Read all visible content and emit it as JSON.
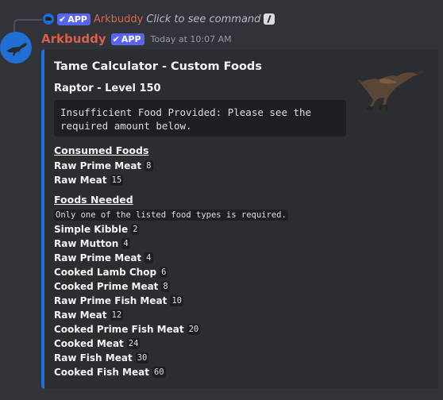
{
  "reply": {
    "badge": "APP",
    "name": "Arkbuddy",
    "command_text": "Click to see command"
  },
  "message": {
    "author": "Arkbuddy",
    "badge": "APP",
    "timestamp": "Today at 10:07 AM"
  },
  "embed": {
    "accent_color": "#1f6fe0",
    "title": "Tame Calculator - Custom Foods",
    "subtitle": "Raptor - Level 150",
    "code": "Insufficient Food Provided: Please see the\nrequired amount below.",
    "consumed_title": "Consumed Foods",
    "consumed": [
      {
        "name": "Raw Prime Meat",
        "qty": "8"
      },
      {
        "name": "Raw Meat",
        "qty": "15"
      }
    ],
    "needed_title": "Foods Needed",
    "needed_note": "Only one of the listed food types is required.",
    "needed": [
      {
        "name": "Simple Kibble",
        "qty": "2"
      },
      {
        "name": "Raw Mutton",
        "qty": "4"
      },
      {
        "name": "Raw Prime Meat",
        "qty": "4"
      },
      {
        "name": "Cooked Lamb Chop",
        "qty": "6"
      },
      {
        "name": "Cooked Prime Meat",
        "qty": "8"
      },
      {
        "name": "Raw Prime Fish Meat",
        "qty": "10"
      },
      {
        "name": "Raw Meat",
        "qty": "12"
      },
      {
        "name": "Cooked Prime Fish Meat",
        "qty": "20"
      },
      {
        "name": "Cooked Meat",
        "qty": "24"
      },
      {
        "name": "Raw Fish Meat",
        "qty": "30"
      },
      {
        "name": "Cooked Fish Meat",
        "qty": "60"
      }
    ]
  }
}
